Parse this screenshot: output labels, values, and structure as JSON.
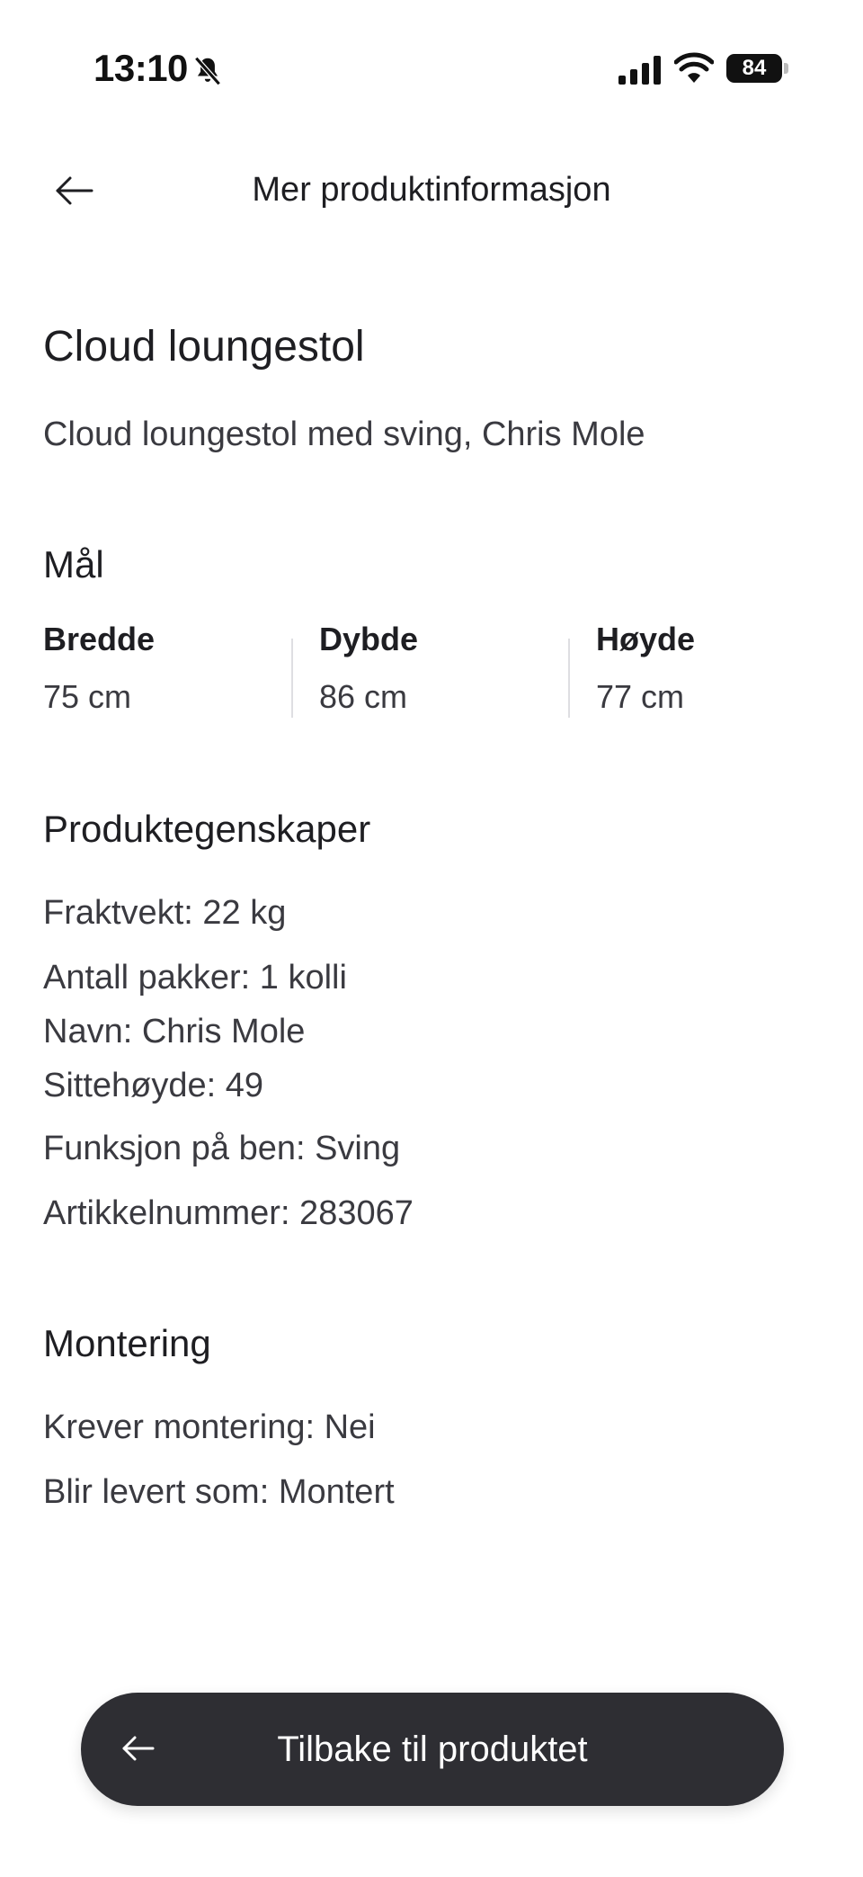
{
  "status_bar": {
    "time": "13:10",
    "battery": "84"
  },
  "header": {
    "title": "Mer produktinformasjon"
  },
  "product": {
    "title": "Cloud loungestol",
    "description": "Cloud loungestol med sving, Chris Mole"
  },
  "dimensions": {
    "section_title": "Mål",
    "items": [
      {
        "label": "Bredde",
        "value": "75 cm"
      },
      {
        "label": "Dybde",
        "value": "86 cm"
      },
      {
        "label": "Høyde",
        "value": "77 cm"
      }
    ]
  },
  "properties": {
    "section_title": "Produktegenskaper",
    "items": [
      "Fraktvekt: 22 kg",
      "Antall pakker: 1 kolli",
      "Navn: Chris Mole",
      "Sittehøyde: 49",
      "Funksjon på ben: Sving",
      "Artikkelnummer: 283067"
    ]
  },
  "assembly": {
    "section_title": "Montering",
    "items": [
      "Krever montering: Nei",
      "Blir levert som: Montert"
    ]
  },
  "bottom_button": {
    "label": "Tilbake til produktet"
  },
  "icons": {
    "bell": "bell-slash-icon",
    "signal": "cellular-signal-icon",
    "wifi": "wifi-icon",
    "back": "arrow-left-icon"
  },
  "colors": {
    "text": "#1e1e22",
    "button_bg": "#2e2e33",
    "button_text": "#ffffff"
  }
}
